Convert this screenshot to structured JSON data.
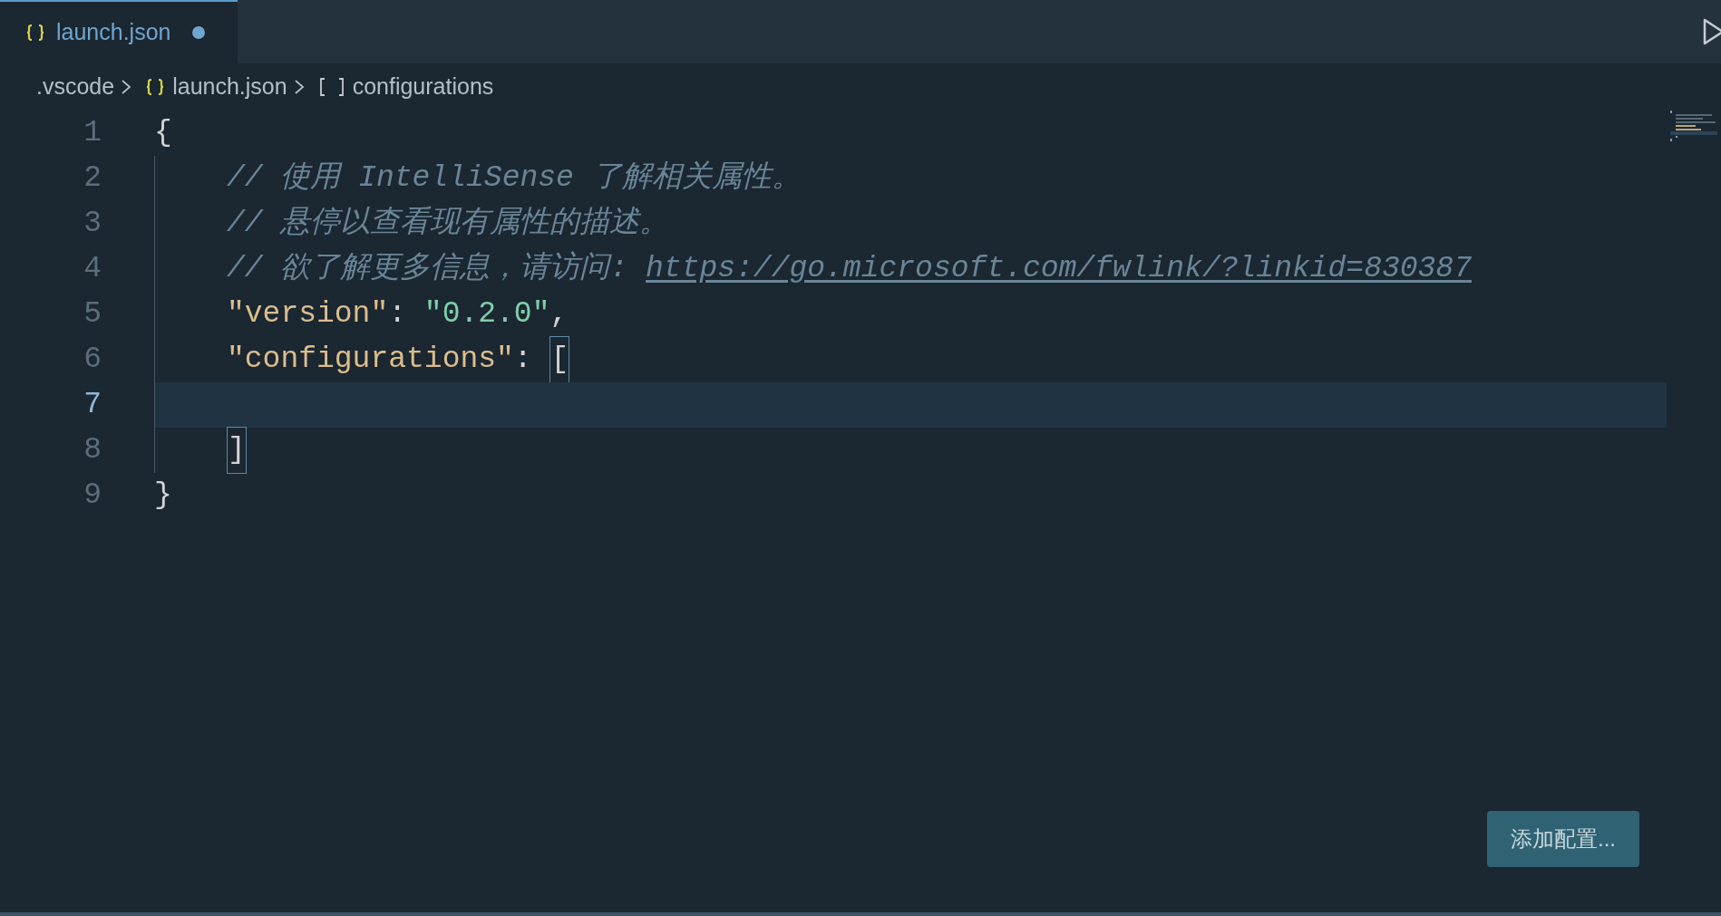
{
  "tab": {
    "label": "launch.json",
    "modified": true,
    "selected": true
  },
  "breadcrumbs": [
    {
      "kind": "folder",
      "label": ".vscode"
    },
    {
      "kind": "file",
      "label": "launch.json"
    },
    {
      "kind": "array",
      "label": "configurations"
    }
  ],
  "lines": [
    {
      "number": "1",
      "current": false,
      "indented": false,
      "tokens": [
        {
          "kind": "punct",
          "text": "{"
        }
      ]
    },
    {
      "number": "2",
      "current": false,
      "indented": true,
      "tokens": [
        {
          "kind": "comment",
          "text": "// 使用 IntelliSense 了解相关属性。"
        }
      ]
    },
    {
      "number": "3",
      "current": false,
      "indented": true,
      "tokens": [
        {
          "kind": "comment",
          "text": "// 悬停以查看现有属性的描述。"
        }
      ]
    },
    {
      "number": "4",
      "current": false,
      "indented": true,
      "tokens": [
        {
          "kind": "comment",
          "text": "// 欲了解更多信息，请访问: "
        },
        {
          "kind": "link",
          "text": "https://go.microsoft.com/fwlink/?linkid=830387"
        }
      ]
    },
    {
      "number": "5",
      "current": false,
      "indented": true,
      "tokens": [
        {
          "kind": "key",
          "text": "\"version\""
        },
        {
          "kind": "punct",
          "text": ": "
        },
        {
          "kind": "string",
          "text": "\"0.2.0\""
        },
        {
          "kind": "punct",
          "text": ","
        }
      ]
    },
    {
      "number": "6",
      "current": false,
      "indented": true,
      "tokens": [
        {
          "kind": "key",
          "text": "\"configurations\""
        },
        {
          "kind": "punct",
          "text": ": "
        },
        {
          "kind": "bracket",
          "text": "[",
          "matched": true
        }
      ]
    },
    {
      "number": "7",
      "current": true,
      "indented": true
    },
    {
      "number": "8",
      "current": false,
      "indented": true,
      "tokens": [
        {
          "kind": "bracket",
          "text": "]",
          "matched": true
        }
      ]
    },
    {
      "number": "9",
      "current": false,
      "indented": false,
      "tokens": [
        {
          "kind": "punct",
          "text": "}"
        }
      ]
    }
  ],
  "add_button": {
    "label": "添加配置..."
  }
}
